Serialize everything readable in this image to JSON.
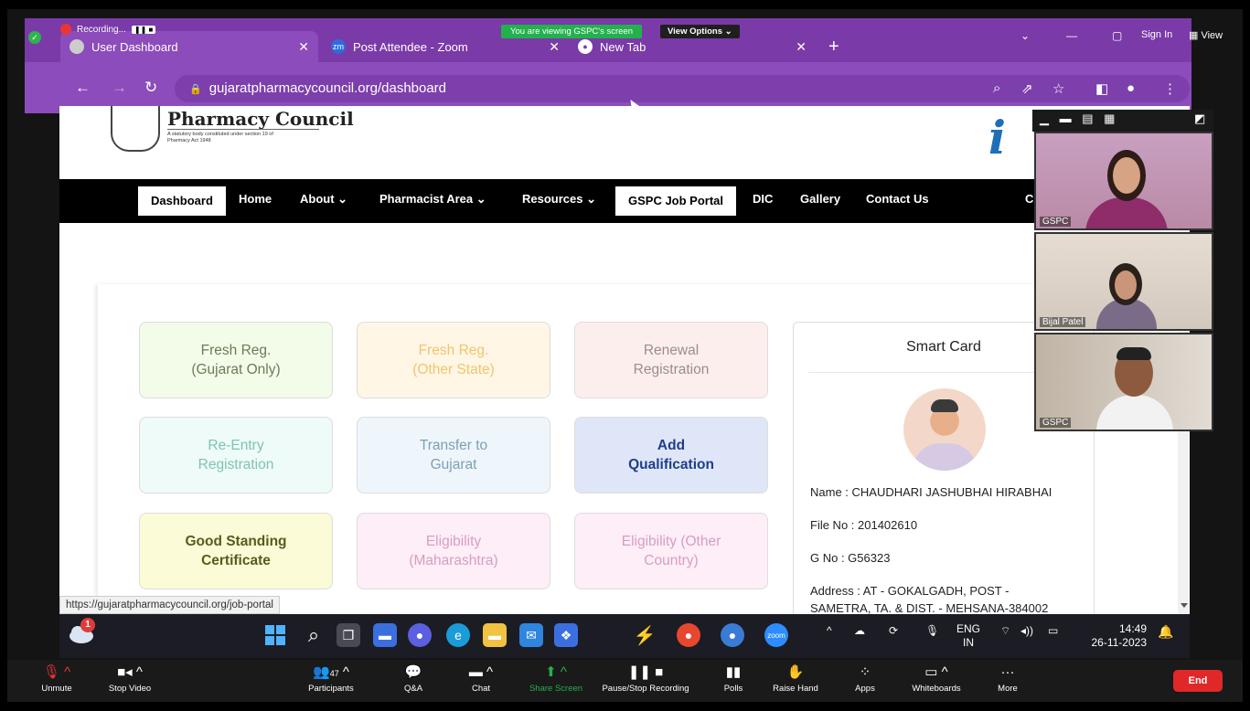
{
  "meeting": {
    "recording_label": "Recording...",
    "viewing_banner": "You are viewing GSPC's screen",
    "view_options": "View Options",
    "sign_in": "Sign In",
    "view": "View"
  },
  "browser": {
    "tabs": [
      {
        "label": "User Dashboard",
        "icon": "web-icon"
      },
      {
        "label": "Post Attendee - Zoom",
        "icon": "zoom-icon"
      },
      {
        "label": "New Tab",
        "icon": "chrome-icon"
      }
    ],
    "url": "gujaratpharmacycouncil.org/dashboard",
    "status_url": "https://gujaratpharmacycouncil.org/job-portal"
  },
  "site": {
    "logo_title": "Pharmacy Council",
    "logo_subtitle": "A statutory body constituted under section 19 of Pharmacy Act 1948",
    "nav": [
      {
        "label": "Dashboard"
      },
      {
        "label": "Home"
      },
      {
        "label": "About ⌄"
      },
      {
        "label": "Pharmacist Area ⌄"
      },
      {
        "label": "Resources ⌄"
      },
      {
        "label": "GSPC Job Portal"
      },
      {
        "label": "DIC"
      },
      {
        "label": "Gallery"
      },
      {
        "label": "Contact Us"
      },
      {
        "label": "C"
      }
    ],
    "tiles": [
      {
        "line1": "Fresh Reg.",
        "line2": "(Gujarat Only)",
        "bg": "#f3fbe9",
        "fg": "#6d7a5a"
      },
      {
        "line1": "Fresh Reg.",
        "line2": "(Other State)",
        "bg": "#fff6e6",
        "fg": "#f2c46c"
      },
      {
        "line1": "Renewal",
        "line2": "Registration",
        "bg": "#fdeeee",
        "fg": "#9e8b8b"
      },
      {
        "line1": "Re-Entry",
        "line2": "Registration",
        "bg": "#eefbf8",
        "fg": "#7ec4b0"
      },
      {
        "line1": "Transfer to",
        "line2": "Gujarat",
        "bg": "#eef6fc",
        "fg": "#7d9fb4"
      },
      {
        "line1": "Add",
        "line2": "Qualification",
        "bg": "#dfe6f7",
        "fg": "#1f3d8a"
      },
      {
        "line1": "Good Standing",
        "line2": "Certificate",
        "bg": "#fbfbd7",
        "fg": "#5b5a1c"
      },
      {
        "line1": "Eligibility",
        "line2": "(Maharashtra)",
        "bg": "#fdeef7",
        "fg": "#d69ec2"
      },
      {
        "line1": "Eligibility (Other",
        "line2": "Country)",
        "bg": "#fdeef7",
        "fg": "#d69ec2"
      }
    ],
    "smart_card": {
      "title": "Smart Card",
      "name": "Name : CHAUDHARI JASHUBHAI HIRABHAI",
      "file_no": "File No : 201402610",
      "g_no": "G No : G56323",
      "address": "Address : AT - GOKALGADH, POST -",
      "address2": "SAMETRA, TA. & DIST. - MEHSANA-384002"
    }
  },
  "participants_video": [
    {
      "name": "GSPC"
    },
    {
      "name": "Bijal Patel"
    },
    {
      "name": "GSPC"
    }
  ],
  "taskbar": {
    "weather_badge": "1",
    "lang": "ENG",
    "region": "IN",
    "time": "14:49",
    "date": "26-11-2023"
  },
  "zoom_toolbar": {
    "unmute": "Unmute",
    "stop_video": "Stop Video",
    "participants": "Participants",
    "participant_count": "47",
    "qa": "Q&A",
    "chat": "Chat",
    "share_screen": "Share Screen",
    "pause_recording": "Pause/Stop Recording",
    "polls": "Polls",
    "raise_hand": "Raise Hand",
    "apps": "Apps",
    "whiteboards": "Whiteboards",
    "more": "More",
    "end": "End"
  },
  "colors": {
    "browser_purple": "#8c4cbb",
    "zoom_green": "#23b14d",
    "end_red": "#e02828"
  }
}
